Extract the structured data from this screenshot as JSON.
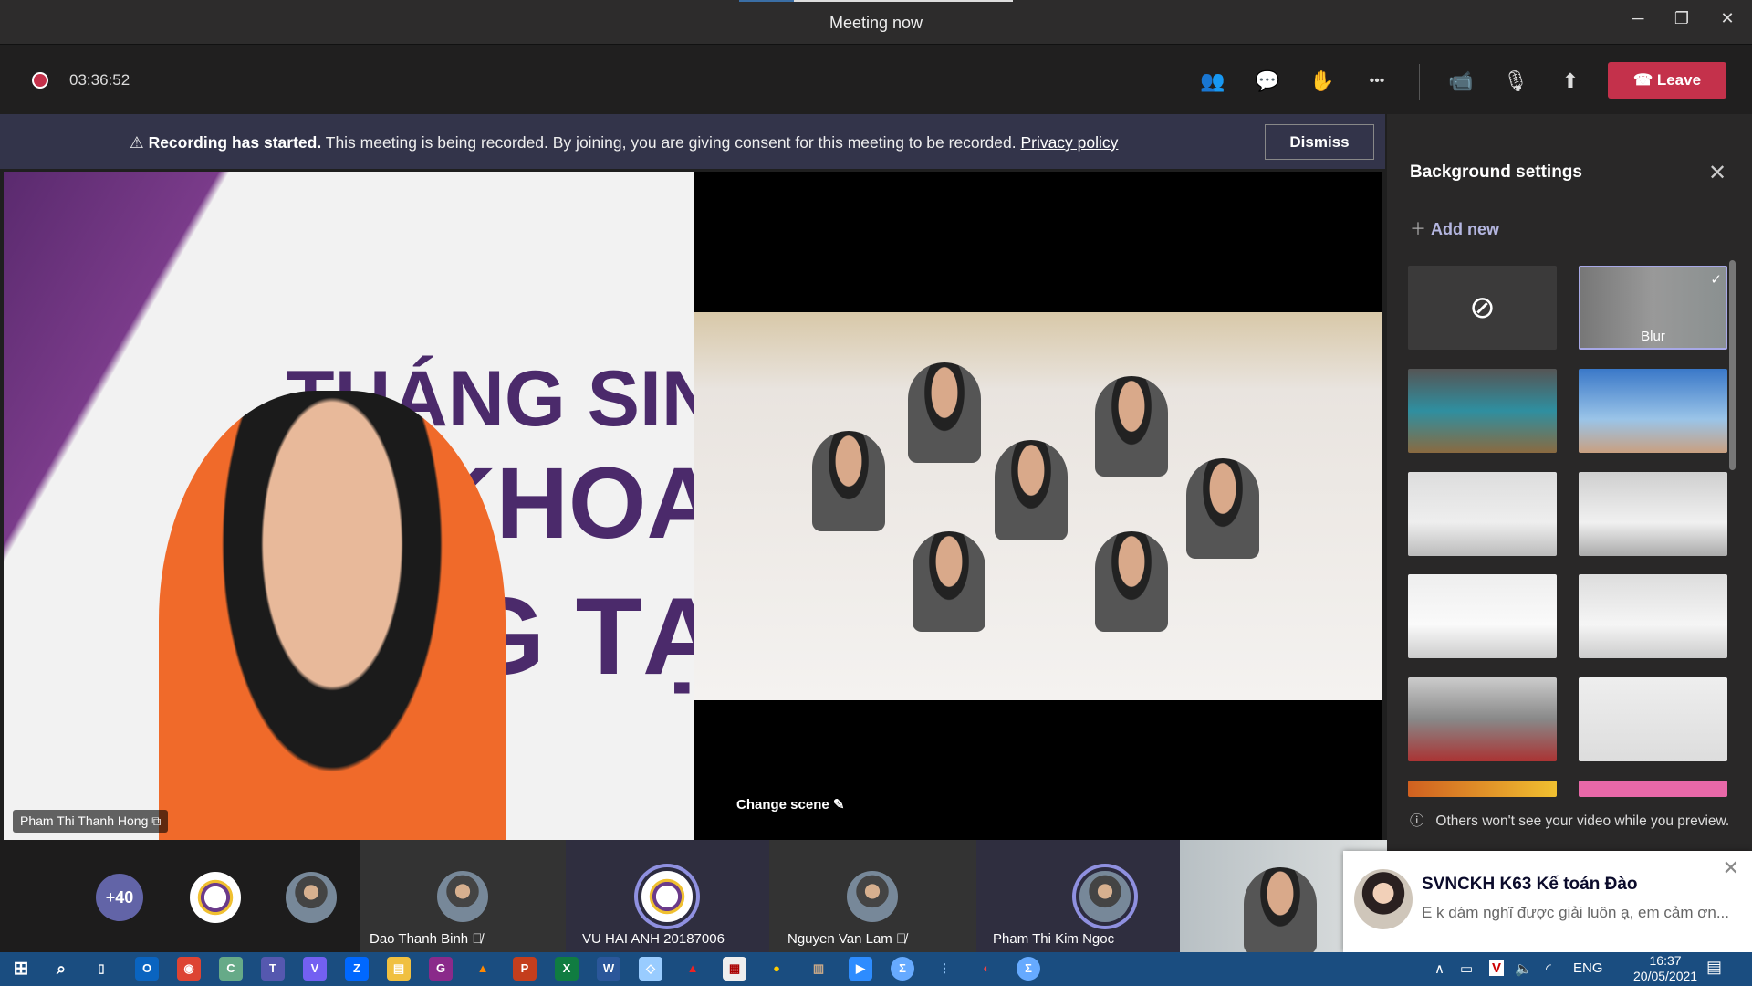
{
  "window": {
    "title": "Meeting now",
    "minimize": "─",
    "restore": "❐",
    "close": "✕"
  },
  "toolbar": {
    "timer": "03:36:52",
    "leave_label": "Leave",
    "icons": [
      "participants-icon",
      "chat-icon",
      "reactions-icon",
      "more-icon",
      "camera-icon",
      "mic-off-icon",
      "share-icon"
    ],
    "more_glyph": "•••"
  },
  "banner": {
    "bold": "Recording has started.",
    "text": "This meeting is being recorded. By joining, you are giving consent for this meeting to be recorded.",
    "link": "Privacy policy",
    "dismiss": "Dismiss"
  },
  "stage": {
    "slide_lines": [
      "THÁNG SINH",
      "KHOA",
      "G TẠO"
    ],
    "speaker_name": "Pham Thi Thanh Hong",
    "change_scene": "Change scene"
  },
  "panel": {
    "title": "Background settings",
    "add_new": "Add new",
    "blur_label": "Blur",
    "info": "Others won't see your video while you preview.",
    "selected": "Blur"
  },
  "participants": {
    "overflow": "+40",
    "tiles": [
      {
        "name": "Dao Thanh Binh",
        "muted": true
      },
      {
        "name": "VU HAI ANH 20187006",
        "muted": false
      },
      {
        "name": "Nguyen Van Lam",
        "muted": true
      },
      {
        "name": "Pham Thi Kim Ngoc",
        "muted": false
      }
    ]
  },
  "toast": {
    "title": "SVNCKH K63 Kế toán Đào",
    "message": "E k dám nghĩ được giải luôn ạ, em cảm ơn..."
  },
  "taskbar": {
    "tray_lang": "ENG",
    "time": "16:37",
    "date": "20/05/2021"
  },
  "colors": {
    "accent": "#6264a7",
    "leave": "#c4314b",
    "banner": "#33344a",
    "taskbar": "#1a4d80"
  }
}
